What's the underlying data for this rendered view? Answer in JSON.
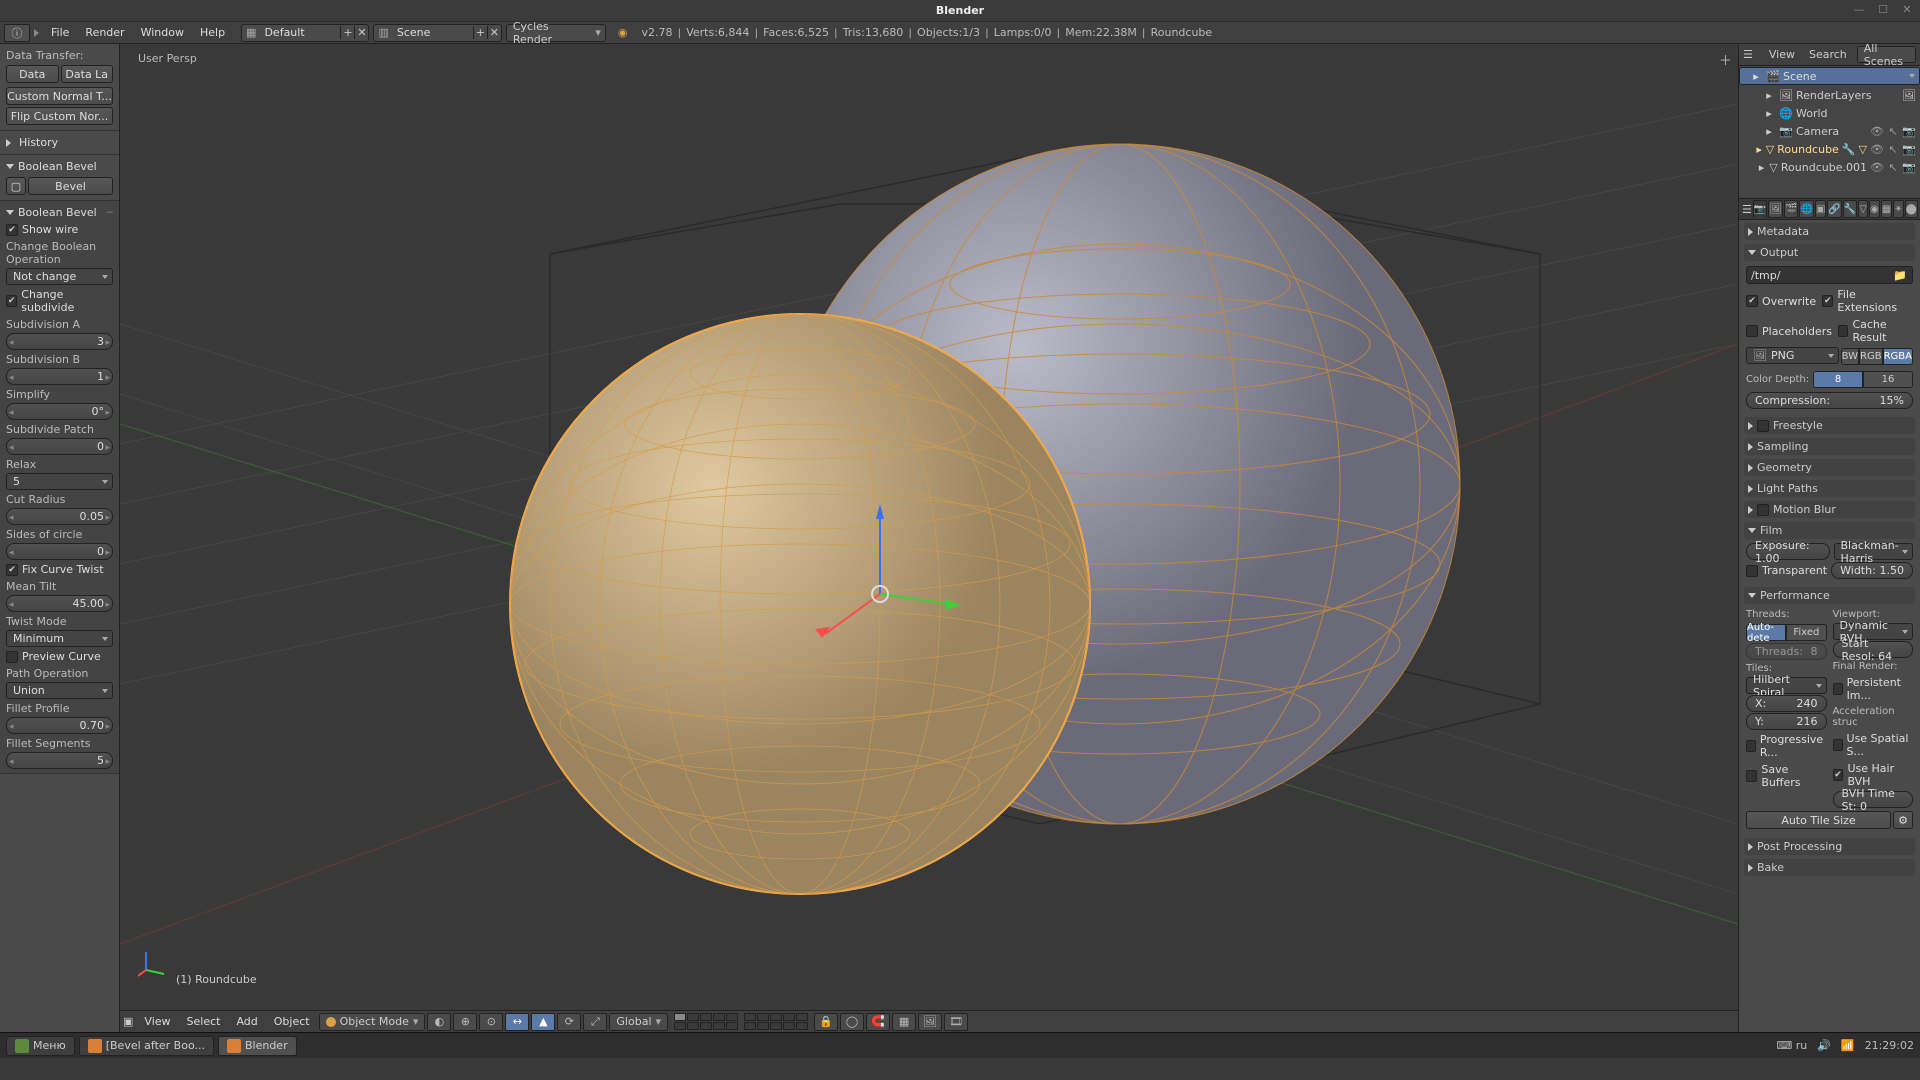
{
  "title": "Blender",
  "menu": {
    "file": "File",
    "render": "Render",
    "window": "Window",
    "help": "Help"
  },
  "layout_field": "Default",
  "scene_field": "Scene",
  "engine": "Cycles Render",
  "stats": {
    "version": "v2.78",
    "verts": "Verts:6,844",
    "faces": "Faces:6,525",
    "tris": "Tris:13,680",
    "objects": "Objects:1/3",
    "lamps": "Lamps:0/0",
    "mem": "Mem:22.38M",
    "active": "Roundcube"
  },
  "left": {
    "data_transfer": "Data Transfer:",
    "data": "Data",
    "data_la": "Data La",
    "custom_normal": "Custom Normal T...",
    "flip_normals": "Flip Custom Nor...",
    "history": "History",
    "boolean_bevel_op": "Boolean Bevel",
    "bevel_btn": "Bevel",
    "panel_title": "Boolean Bevel",
    "show_wire": "Show wire",
    "change_bool": "Change Boolean Operation",
    "change_bool_val": "Not change",
    "change_subdiv": "Change subdivide",
    "sub_a": "Subdivision A",
    "sub_a_v": "3",
    "sub_b": "Subdivision B",
    "sub_b_v": "1",
    "simplify": "Simplify",
    "simplify_v": "0°",
    "sub_patch": "Subdivide Patch",
    "sub_patch_v": "0",
    "relax": "Relax",
    "relax_v": "5",
    "cut_r": "Cut Radius",
    "cut_r_v": "0.05",
    "sides": "Sides of circle",
    "sides_v": "0",
    "fix_twist": "Fix Curve Twist",
    "mean_tilt": "Mean Tilt",
    "mean_tilt_v": "45.00",
    "twist_mode": "Twist Mode",
    "twist_mode_v": "Minimum",
    "preview": "Preview Curve",
    "path_op": "Path Operation",
    "path_op_v": "Union",
    "fillet_p": "Fillet Profile",
    "fillet_p_v": "0.70",
    "fillet_s": "Fillet Segments",
    "fillet_s_v": "5"
  },
  "viewport": {
    "label": "User Persp",
    "objname": "(1) Roundcube",
    "header": {
      "view": "View",
      "select": "Select",
      "add": "Add",
      "object": "Object",
      "mode": "Object Mode",
      "orient": "Global"
    }
  },
  "outliner": {
    "view": "View",
    "search": "Search",
    "scope": "All Scenes",
    "tree": [
      {
        "depth": 0,
        "icon": "🎬",
        "name": "Scene",
        "sel": true
      },
      {
        "depth": 1,
        "icon": "🖼",
        "name": "RenderLayers",
        "extra": "img"
      },
      {
        "depth": 1,
        "icon": "🌐",
        "name": "World"
      },
      {
        "depth": 1,
        "icon": "📷",
        "name": "Camera",
        "rops": true,
        "restrict": true
      },
      {
        "depth": 1,
        "icon": "▽",
        "name": "Roundcube",
        "rops": true,
        "hl": true,
        "mods": true
      },
      {
        "depth": 1,
        "icon": "▽",
        "name": "Roundcube.001",
        "rops": true
      }
    ]
  },
  "props": {
    "metadata": "Metadata",
    "output": "Output",
    "out_path": "/tmp/",
    "overwrite": "Overwrite",
    "file_ext": "File Extensions",
    "placeholders": "Placeholders",
    "cache_result": "Cache Result",
    "format": "PNG",
    "bw": "BW",
    "rgb": "RGB",
    "rgba": "RGBA",
    "color_depth": "Color Depth:",
    "cd8": "8",
    "cd16": "16",
    "compression": "Compression:",
    "compression_v": "15%",
    "freestyle": "Freestyle",
    "sampling": "Sampling",
    "geometry": "Geometry",
    "light_paths": "Light Paths",
    "motion_blur": "Motion Blur",
    "film": "Film",
    "exposure": "Exposure: 1.00",
    "filter": "Blackman-Harris",
    "transparent": "Transparent",
    "width": "Width:",
    "width_v": "1.50",
    "performance": "Performance",
    "threads": "Threads:",
    "viewport_lbl": "Viewport:",
    "autodetect": "Auto-dete",
    "fixed": "Fixed",
    "dynbvh": "Dynamic BVH",
    "threads_num": "Threads:",
    "threads_num_v": "8",
    "start_res": "Start Resol: 64",
    "tiles": "Tiles:",
    "final_render": "Final Render:",
    "tile_order": "Hilbert Spiral",
    "persistent": "Persistent Im...",
    "tile_x": "X:",
    "tile_x_v": "240",
    "accel": "Acceleration struc",
    "tile_y": "Y:",
    "tile_y_v": "216",
    "use_spatial": "Use Spatial S...",
    "progressive": "Progressive R...",
    "use_hair": "Use Hair BVH",
    "save_buffers": "Save Buffers",
    "bvh_time": "BVH Time St: 0",
    "auto_tile": "Auto Tile Size",
    "post_proc": "Post Processing",
    "bake": "Bake"
  },
  "taskbar": {
    "menu": "Меню",
    "tab1": "[Bevel after Boo...",
    "tab2": "Blender",
    "kb": "ru",
    "clock": "21:29:02"
  }
}
